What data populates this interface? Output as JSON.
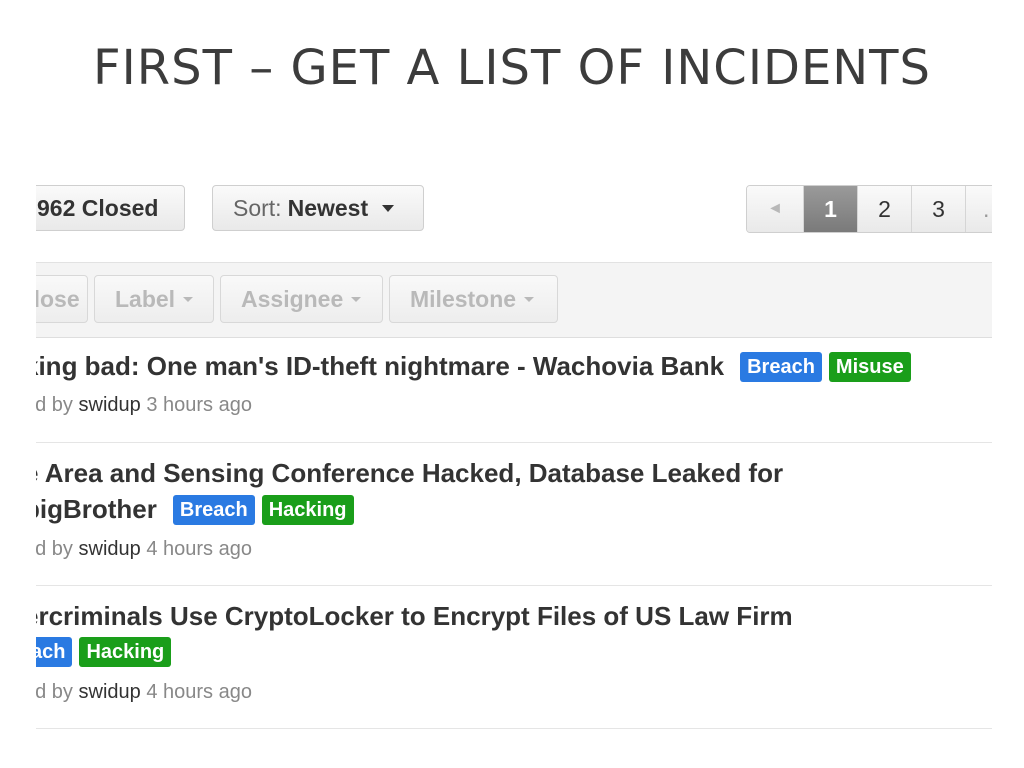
{
  "slide": {
    "title": "First – get a list of incidents"
  },
  "toolbar": {
    "closed_label": "962 Closed",
    "sort_prefix": "Sort:",
    "sort_value": "Newest"
  },
  "pagination": {
    "prev": "◄",
    "pages": [
      "1",
      "2",
      "3"
    ],
    "current": "1",
    "more": "…"
  },
  "filters": {
    "close": "Close",
    "label": "Label",
    "assignee": "Assignee",
    "milestone": "Milestone"
  },
  "colors": {
    "breach": "#2a7ae2",
    "hacking": "#1a9e1a",
    "misuse": "#1a9e1a"
  },
  "issues": [
    {
      "title_line1": "king bad: One man's ID-theft nightmare - Wachovia Bank",
      "labels": [
        "Breach",
        "Misuse"
      ],
      "meta_prefix": "ed by",
      "author": "swidup",
      "time": "3 hours ago"
    },
    {
      "title_line1": "e Area and Sensing Conference Hacked, Database Leaked for",
      "title_line2": "bigBrother",
      "labels": [
        "Breach",
        "Hacking"
      ],
      "meta_prefix": "ed by",
      "author": "swidup",
      "time": "4 hours ago"
    },
    {
      "title_line1": "ercriminals Use CryptoLocker to Encrypt Files of US Law Firm",
      "labels": [
        "ach",
        "Hacking"
      ],
      "meta_prefix": "ed by",
      "author": "swidup",
      "time": "4 hours ago"
    }
  ]
}
